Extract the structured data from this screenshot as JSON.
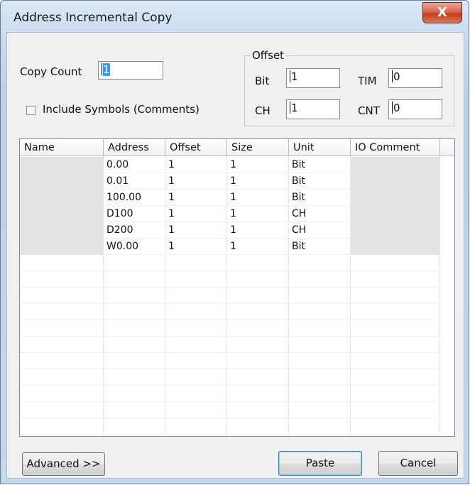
{
  "window": {
    "title": "Address Incremental Copy",
    "close_glyph": "X"
  },
  "copy_count": {
    "label": "Copy Count",
    "value": "1"
  },
  "include_symbols": {
    "label": "Include Symbols (Comments)",
    "checked": false
  },
  "offset": {
    "group_label": "Offset",
    "bit": {
      "label": "Bit",
      "value": "1"
    },
    "tim": {
      "label": "TIM",
      "value": "0"
    },
    "ch": {
      "label": "CH",
      "value": "1"
    },
    "cnt": {
      "label": "CNT",
      "value": "0"
    }
  },
  "table": {
    "columns": [
      "Name",
      "Address",
      "Offset",
      "Size",
      "Unit",
      "IO Comment"
    ],
    "rows": [
      {
        "name": "",
        "address": "0.00",
        "offset": "1",
        "size": "1",
        "unit": "Bit",
        "comment": ""
      },
      {
        "name": "",
        "address": "0.01",
        "offset": "1",
        "size": "1",
        "unit": "Bit",
        "comment": ""
      },
      {
        "name": "",
        "address": "100.00",
        "offset": "1",
        "size": "1",
        "unit": "Bit",
        "comment": ""
      },
      {
        "name": "",
        "address": "D100",
        "offset": "1",
        "size": "1",
        "unit": "CH",
        "comment": ""
      },
      {
        "name": "",
        "address": "D200",
        "offset": "1",
        "size": "1",
        "unit": "CH",
        "comment": ""
      },
      {
        "name": "",
        "address": "W0.00",
        "offset": "1",
        "size": "1",
        "unit": "Bit",
        "comment": ""
      }
    ]
  },
  "buttons": {
    "advanced": "Advanced >>",
    "paste": "Paste",
    "cancel": "Cancel"
  },
  "colors": {
    "readonly_cell": "#e3e3e5",
    "title_gradient": "#c6daf0",
    "close_red": "#c33e20",
    "selection": "#3399ff"
  }
}
